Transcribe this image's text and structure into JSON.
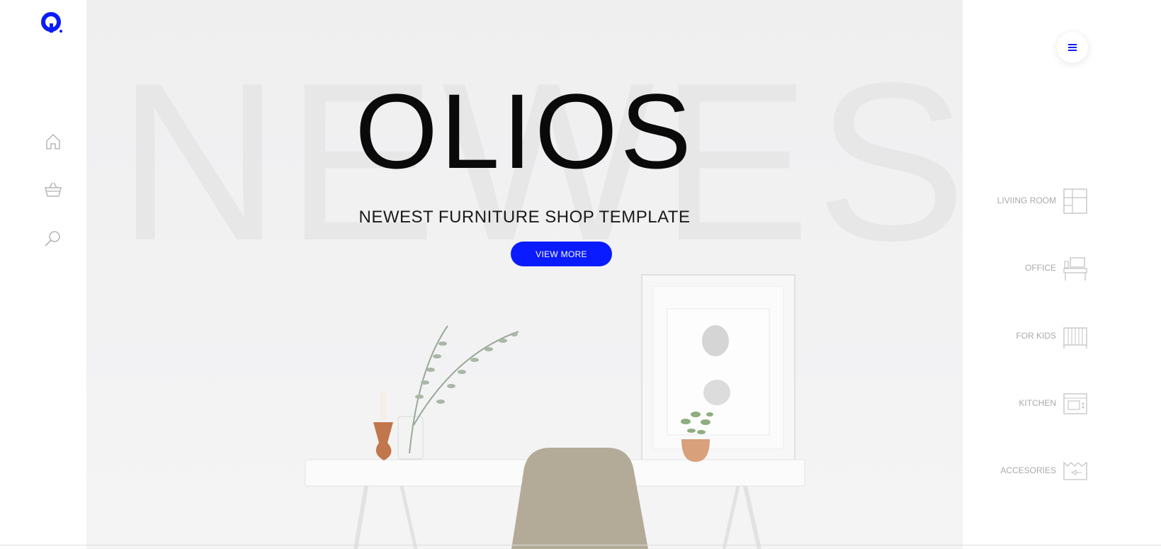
{
  "hero": {
    "background_word": "NEWEST",
    "title": "OLIOS",
    "subtitle": "NEWEST FURNITURE SHOP TEMPLATE",
    "cta_label": "VIEW MORE"
  },
  "sidebar": {
    "icons": [
      "home-icon",
      "basket-icon",
      "search-icon"
    ]
  },
  "categories": [
    {
      "label": "LIVIING ROOM",
      "icon": "shelf-icon"
    },
    {
      "label": "OFFICE",
      "icon": "desk-icon"
    },
    {
      "label": "FOR KIDS",
      "icon": "crib-icon"
    },
    {
      "label": "KITCHEN",
      "icon": "stove-icon"
    },
    {
      "label": "ACCESORIES",
      "icon": "accessory-icon"
    }
  ],
  "colors": {
    "accent": "#0a1bff",
    "category_text": "#a9a9a9",
    "hero_bg": "#f1f1f2"
  }
}
